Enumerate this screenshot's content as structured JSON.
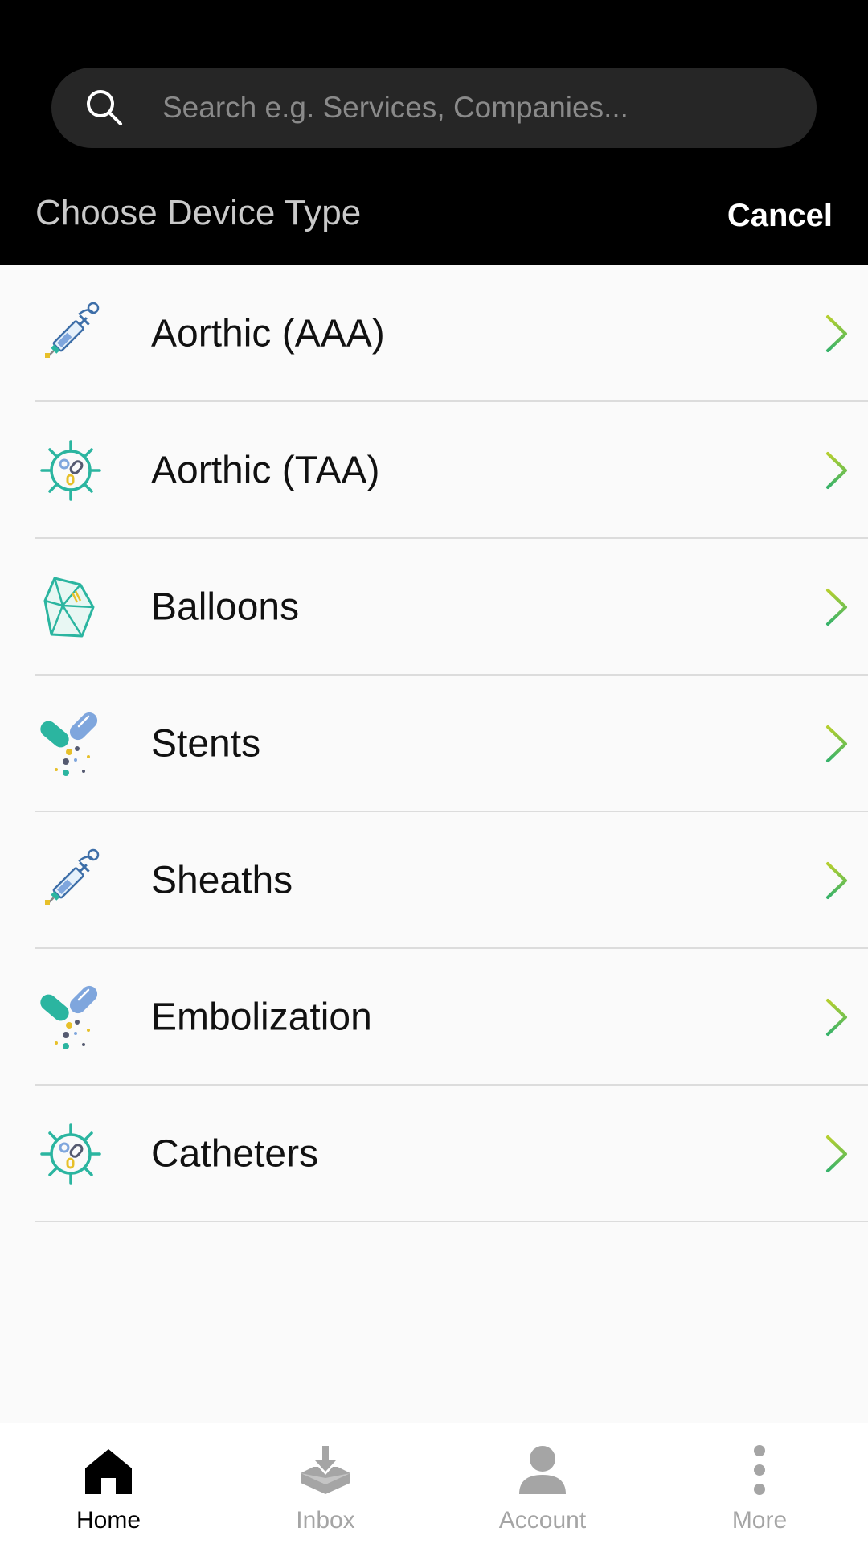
{
  "search": {
    "placeholder": "Search e.g. Services, Companies..."
  },
  "header": {
    "title": "Choose Device Type",
    "cancel_label": "Cancel"
  },
  "device_types": [
    {
      "label": "Aorthic (AAA)",
      "icon": "syringe-icon"
    },
    {
      "label": "Aorthic (TAA)",
      "icon": "virus-icon"
    },
    {
      "label": "Balloons",
      "icon": "crystal-icon"
    },
    {
      "label": "Stents",
      "icon": "capsules-icon"
    },
    {
      "label": "Sheaths",
      "icon": "syringe-icon"
    },
    {
      "label": "Embolization",
      "icon": "capsules-icon"
    },
    {
      "label": "Catheters",
      "icon": "virus-icon"
    }
  ],
  "tabbar": {
    "tabs": [
      {
        "label": "Home",
        "icon": "home-icon",
        "active": true
      },
      {
        "label": "Inbox",
        "icon": "inbox-icon",
        "active": false
      },
      {
        "label": "Account",
        "icon": "account-icon",
        "active": false
      },
      {
        "label": "More",
        "icon": "more-icon",
        "active": false
      }
    ]
  },
  "colors": {
    "header_bg": "#000000",
    "search_bg": "#262626",
    "chevron": "#6cbf3f",
    "teal": "#2bb5a0",
    "blue": "#7fa6dd",
    "yellow": "#e7c02a",
    "tab_active": "#000000",
    "tab_inactive": "#a5a5a5"
  }
}
